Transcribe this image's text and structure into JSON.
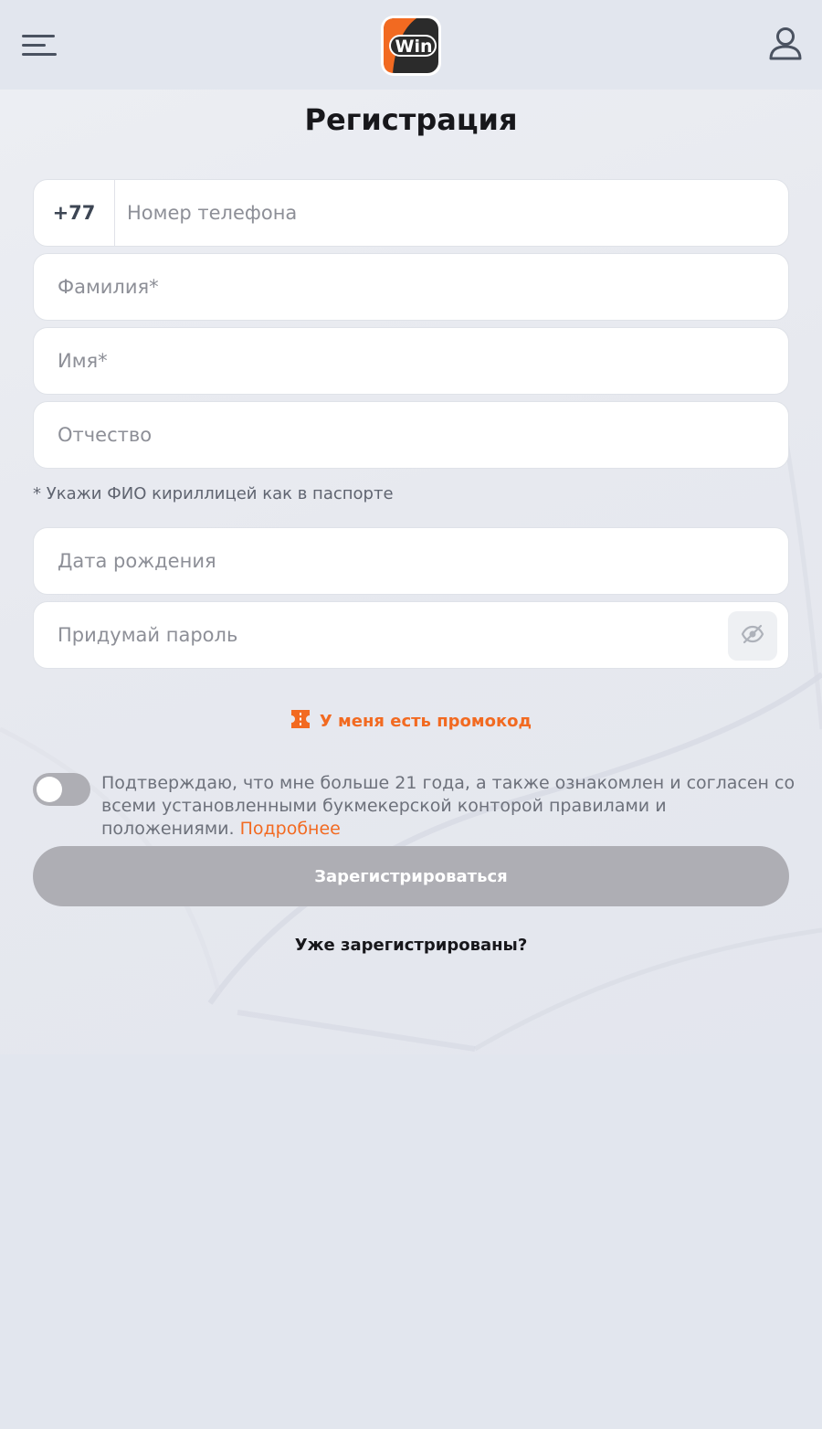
{
  "header": {
    "menu_icon": "hamburger-menu-icon",
    "user_icon": "user-profile-icon",
    "logo_text": "Win"
  },
  "page": {
    "title": "Регистрация"
  },
  "form": {
    "phone_prefix": "+77",
    "phone_placeholder": "Номер телефона",
    "surname_placeholder": "Фамилия*",
    "name_placeholder": "Имя*",
    "patronymic_placeholder": "Отчество",
    "name_hint": "* Укажи ФИО кириллицей как в паспорте",
    "birthdate_placeholder": "Дата рождения",
    "password_placeholder": "Придумай пароль",
    "password_toggle_icon": "eye-off-icon"
  },
  "promo": {
    "label": "У меня есть промокод",
    "icon": "coupon-icon"
  },
  "consent": {
    "text": "Подтверждаю, что мне больше 21 года, а также ознакомлен и согласен со всеми установленными букмекерской конторой правилами и положениями.",
    "more_link": "Подробнее",
    "toggle_on": false
  },
  "actions": {
    "submit_label": "Зарегистрироваться",
    "login_link": "Уже зарегистрированы?"
  },
  "colors": {
    "accent": "#f26a21",
    "disabled_button": "#aeaeb4",
    "background": "#e2e6ee"
  }
}
